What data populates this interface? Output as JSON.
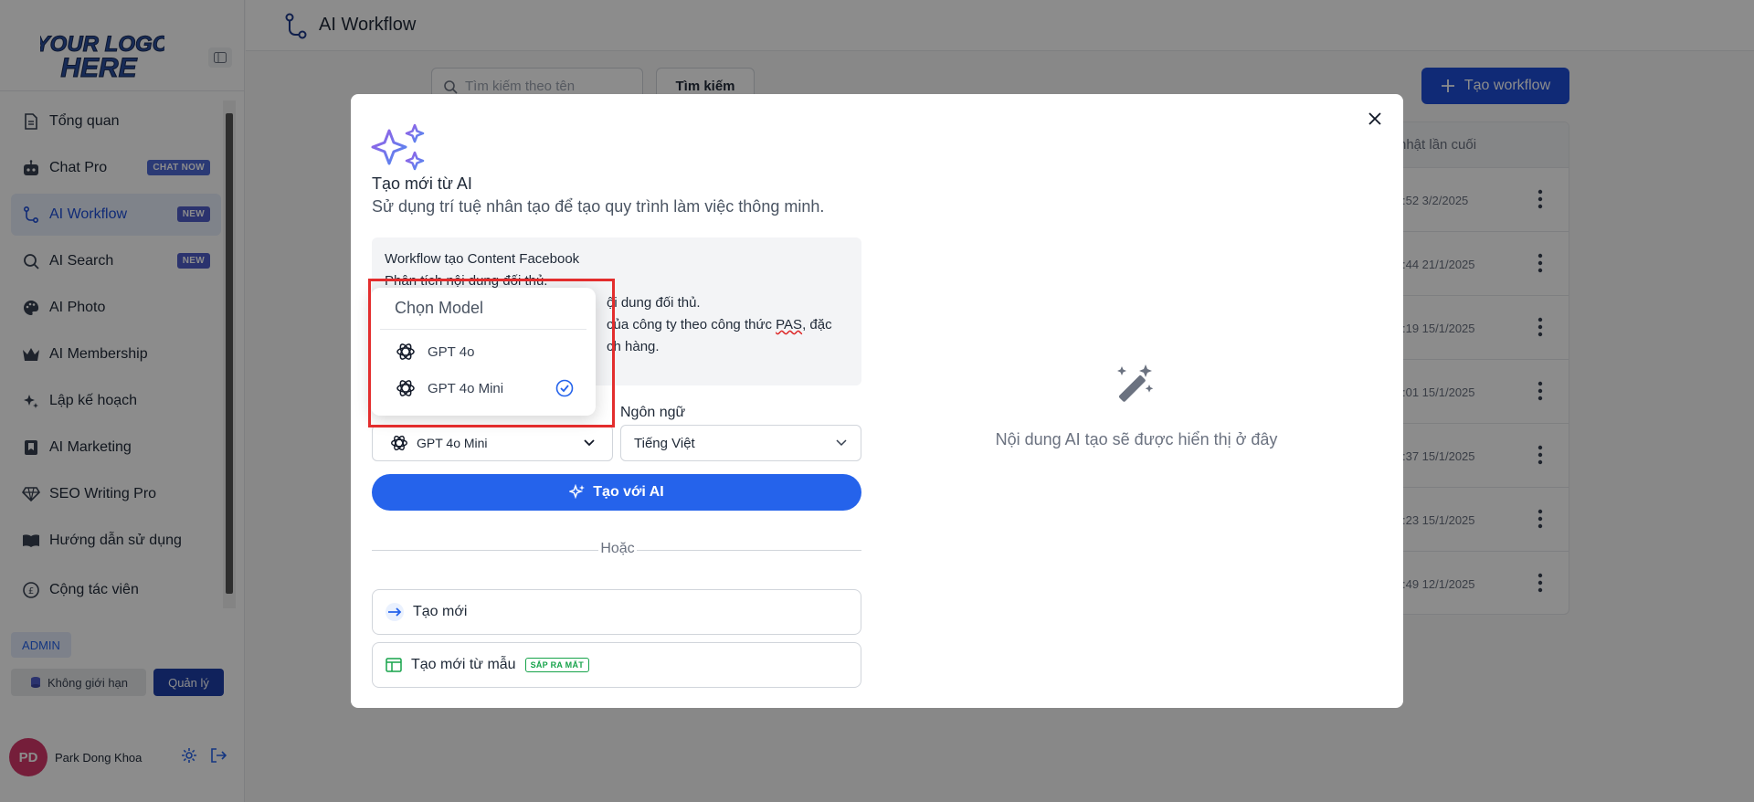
{
  "sidebar": {
    "logo_text": [
      "YOUR LOGO",
      "HERE"
    ],
    "items": [
      {
        "label": "Tổng quan",
        "icon": "document-icon",
        "badge": ""
      },
      {
        "label": "Chat Pro",
        "icon": "robot-icon",
        "badge": "CHAT NOW"
      },
      {
        "label": "AI Workflow",
        "icon": "workflow-icon",
        "badge": "NEW"
      },
      {
        "label": "AI Search",
        "icon": "search-icon",
        "badge": "NEW"
      },
      {
        "label": "AI Photo",
        "icon": "palette-icon",
        "badge": ""
      },
      {
        "label": "AI Membership",
        "icon": "crown-icon",
        "badge": ""
      },
      {
        "label": "Lập kế hoạch",
        "icon": "sparkle-icon",
        "badge": ""
      },
      {
        "label": "AI Marketing",
        "icon": "bookmark-icon",
        "badge": ""
      },
      {
        "label": "SEO Writing Pro",
        "icon": "diamond-icon",
        "badge": ""
      },
      {
        "label": "Hướng dẫn sử dụng",
        "icon": "book-icon",
        "badge": ""
      },
      {
        "label": "Cộng tác viên",
        "icon": "pound-coin-icon",
        "badge": ""
      }
    ],
    "admin_label": "ADMIN",
    "limit_label": "Không giới hạn",
    "manage_label": "Quản lý",
    "user": {
      "initials": "PD",
      "name": "Park Dong Khoa"
    }
  },
  "header": {
    "title": "AI Workflow"
  },
  "toolbar": {
    "search_placeholder": "Tìm kiếm theo tên",
    "search_button": "Tìm kiếm",
    "create_button": "Tạo workflow"
  },
  "table": {
    "last_updated_header": "nhật lần cuối",
    "rows": [
      {
        "date": ":52 3/2/2025"
      },
      {
        "date": ":44 21/1/2025"
      },
      {
        "date": ":19 15/1/2025"
      },
      {
        "date": ":01 15/1/2025"
      },
      {
        "date": ":37 15/1/2025"
      },
      {
        "date": ":23 15/1/2025"
      },
      {
        "date": ":49 12/1/2025"
      }
    ]
  },
  "modal": {
    "title": "Tạo mới từ AI",
    "subtitle": "Sử dụng trí tuệ nhân tạo để tạo quy trình làm việc thông minh.",
    "prompt_lines": [
      "Workflow tạo Content Facebook",
      "Phân tích nội dung đối thủ.",
      "ội dung đối thủ.",
      "của công ty theo công thức ",
      "ch hàng."
    ],
    "prompt_pas": "PAS",
    "prompt_tail": ", đặc",
    "language_label": "Ngôn ngữ",
    "model_value": "GPT 4o Mini",
    "language_value": "Tiếng Việt",
    "generate_button": "Tạo với AI",
    "or_text": "Hoặc",
    "create_new": "Tạo mới",
    "create_from_template": "Tạo mới từ mẫu",
    "coming_soon_badge": "SẮP RA MẮT",
    "empty_text": "Nội dung AI tạo sẽ được hiển thị ở đây"
  },
  "model_dropdown": {
    "header": "Chọn Model",
    "options": [
      {
        "label": "GPT 4o",
        "selected": false
      },
      {
        "label": "GPT 4o Mini",
        "selected": true
      }
    ]
  },
  "colors": {
    "primary": "#2563eb",
    "primary_dark": "#1e4ed8",
    "highlight_border": "#e32d2d",
    "badge": "#4f5ec9"
  }
}
